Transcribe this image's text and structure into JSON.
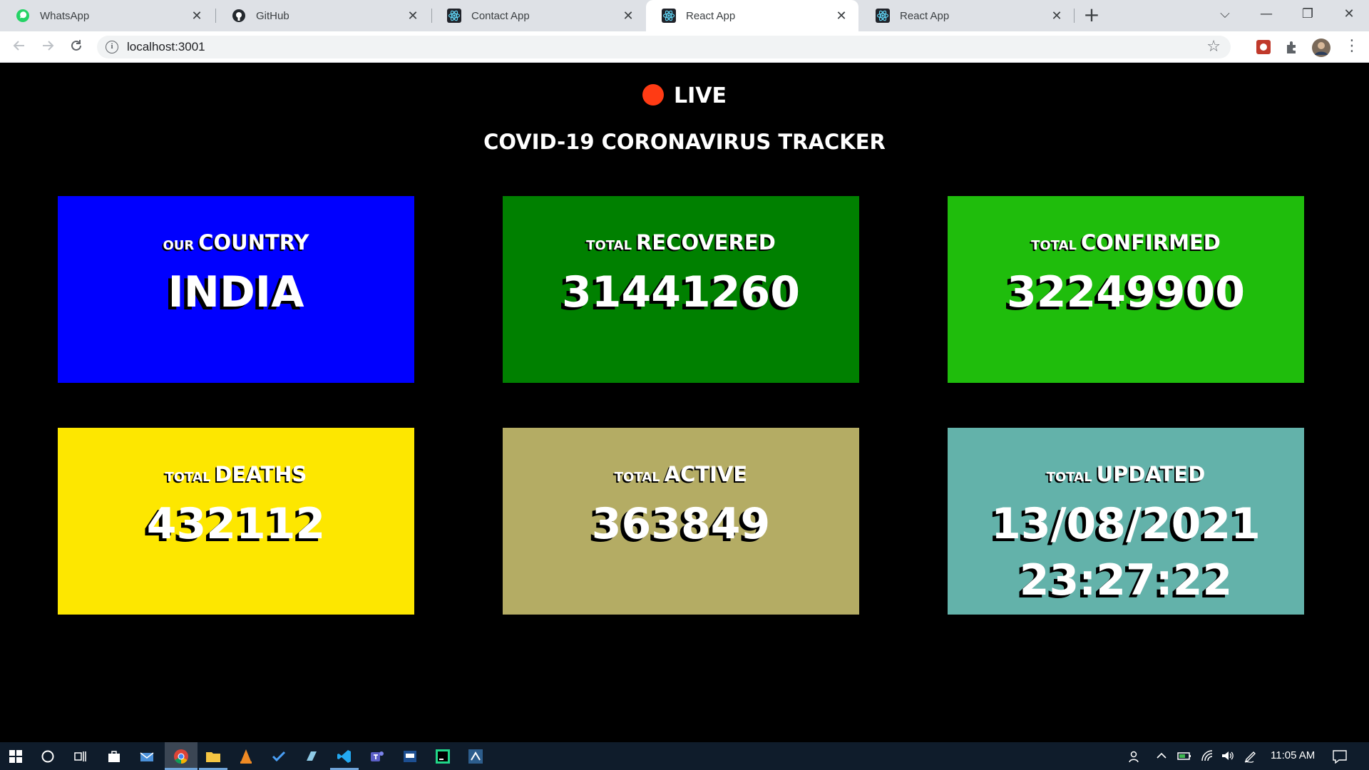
{
  "browser": {
    "tabs": [
      {
        "title": "WhatsApp",
        "icon": "whatsapp-icon",
        "active": false
      },
      {
        "title": "GitHub",
        "icon": "github-icon",
        "active": false
      },
      {
        "title": "Contact App",
        "icon": "react-icon",
        "active": false
      },
      {
        "title": "React App",
        "icon": "react-icon",
        "active": true
      },
      {
        "title": "React App",
        "icon": "react-icon",
        "active": false
      }
    ],
    "close_glyph": "✕",
    "new_tab_glyph": "+",
    "url": "localhost:3001",
    "window_controls": {
      "tab_search": "⌵",
      "minimize": "—",
      "restore": "❐",
      "close": "✕"
    }
  },
  "page": {
    "live_label": "LIVE",
    "title": "COVID-19 CORONAVIRUS TRACKER",
    "cards": [
      {
        "prefix": "OUR",
        "label": "COUNTRY",
        "value": "INDIA",
        "color": "#0000ff"
      },
      {
        "prefix": "TOTAL",
        "label": "RECOVERED",
        "value": "31441260",
        "color": "#008000"
      },
      {
        "prefix": "TOTAL",
        "label": "CONFIRMED",
        "value": "32249900",
        "color": "#1fbd0c"
      },
      {
        "prefix": "TOTAL",
        "label": "DEATHS",
        "value": "432112",
        "color": "#fde700"
      },
      {
        "prefix": "TOTAL",
        "label": "ACTIVE",
        "value": "363849",
        "color": "#b4ac64"
      },
      {
        "prefix": "TOTAL",
        "label": "UPDATED",
        "value": "13/08/2021",
        "value_line2": "23:27:22",
        "color": "#63b2aa"
      }
    ]
  },
  "taskbar": {
    "clock": "11:05 AM"
  }
}
